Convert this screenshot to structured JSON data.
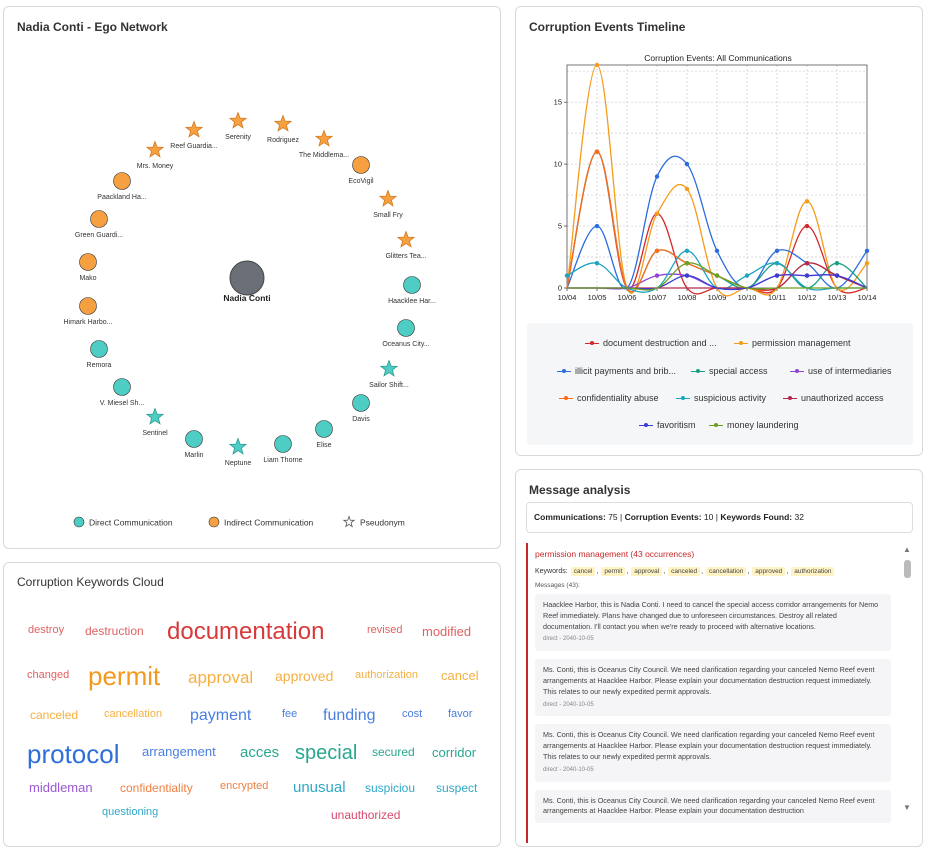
{
  "network": {
    "title": "Nadia Conti - Ego Network",
    "center": "Nadia Conti",
    "nodes": [
      {
        "label": "Reef Guardia...",
        "type": "pseudonym"
      },
      {
        "label": "Serenity",
        "type": "pseudonym"
      },
      {
        "label": "Rodriguez",
        "type": "pseudonym"
      },
      {
        "label": "The Middlema...",
        "type": "pseudonym"
      },
      {
        "label": "EcoVigil",
        "type": "indirect"
      },
      {
        "label": "Small Fry",
        "type": "pseudonym"
      },
      {
        "label": "Glitters Tea...",
        "type": "pseudonym"
      },
      {
        "label": "Haacklee Har...",
        "type": "direct"
      },
      {
        "label": "Oceanus City...",
        "type": "direct"
      },
      {
        "label": "Sailor Shift...",
        "type": "pseudonym_direct"
      },
      {
        "label": "Davis",
        "type": "direct"
      },
      {
        "label": "Elise",
        "type": "direct"
      },
      {
        "label": "Liam Thorne",
        "type": "direct"
      },
      {
        "label": "Neptune",
        "type": "pseudonym_direct"
      },
      {
        "label": "Marlin",
        "type": "direct"
      },
      {
        "label": "Sentinel",
        "type": "pseudonym_direct"
      },
      {
        "label": "V. Miesel Sh...",
        "type": "direct"
      },
      {
        "label": "Remora",
        "type": "direct"
      },
      {
        "label": "Himark Harbo...",
        "type": "indirect"
      },
      {
        "label": "Mako",
        "type": "indirect"
      },
      {
        "label": "Green Guardi...",
        "type": "indirect"
      },
      {
        "label": "Paackland Ha...",
        "type": "indirect"
      },
      {
        "label": "Mrs. Money",
        "type": "pseudonym"
      }
    ],
    "legend": {
      "direct": "Direct Communication",
      "indirect": "Indirect Communication",
      "pseudonym": "Pseudonym"
    },
    "colors": {
      "direct": "#4ecdc4",
      "indirect": "#f7a042",
      "center": "#6b7078"
    }
  },
  "timeline": {
    "title": "Corruption Events Timeline"
  },
  "chart_data": {
    "type": "line",
    "title": "Corruption Events: All Communications",
    "x": [
      "10/04",
      "10/05",
      "10/06",
      "10/07",
      "10/08",
      "10/09",
      "10/10",
      "10/11",
      "10/12",
      "10/13",
      "10/14"
    ],
    "ylim": [
      0,
      18
    ],
    "yticks": [
      0,
      5,
      10,
      15
    ],
    "grid": true,
    "series": [
      {
        "name": "document destruction and ...",
        "color": "#d62728",
        "values": [
          0,
          11,
          0,
          6,
          0,
          0,
          0,
          0,
          5,
          0,
          0
        ]
      },
      {
        "name": "permission management",
        "color": "#f59c1a",
        "values": [
          0,
          18,
          0,
          6,
          8,
          0,
          0,
          0,
          7,
          0,
          2
        ]
      },
      {
        "name": "illicit payments and brib...",
        "color": "#2b6cdf",
        "values": [
          0,
          5,
          0,
          9,
          10,
          3,
          0,
          3,
          2,
          0,
          3
        ]
      },
      {
        "name": "special access",
        "color": "#17a085",
        "values": [
          0,
          11,
          0,
          3,
          2,
          1,
          0,
          2,
          0,
          2,
          0
        ]
      },
      {
        "name": "use of intermediaries",
        "color": "#8e44d9",
        "values": [
          0,
          0,
          0,
          1,
          1,
          0,
          0,
          1,
          1,
          1,
          0
        ]
      },
      {
        "name": "confidentiality abuse",
        "color": "#ff6b1a",
        "values": [
          0,
          11,
          0,
          3,
          2,
          1,
          0,
          0,
          2,
          1,
          0
        ]
      },
      {
        "name": "suspicious activity",
        "color": "#1ea3c0",
        "values": [
          1,
          2,
          0,
          0,
          3,
          0,
          1,
          2,
          0,
          0,
          0
        ]
      },
      {
        "name": "unauthorized access",
        "color": "#b22a4a",
        "values": [
          0,
          0,
          0,
          0,
          0,
          0,
          0,
          0,
          2,
          1,
          0
        ]
      },
      {
        "name": "favoritism",
        "color": "#3b3bd6",
        "values": [
          0,
          0,
          0,
          0,
          1,
          0,
          0,
          1,
          1,
          1,
          0
        ]
      },
      {
        "name": "money laundering",
        "color": "#6aa020",
        "values": [
          0,
          0,
          0,
          0,
          2,
          1,
          0,
          0,
          0,
          0,
          0
        ]
      }
    ]
  },
  "keywords": {
    "title": "Corruption Keywords Cloud",
    "words": [
      {
        "text": "destroy",
        "color": "#e06262",
        "size": 11
      },
      {
        "text": "destruction",
        "color": "#e06262",
        "size": 12
      },
      {
        "text": "documentation",
        "color": "#d63a3a",
        "size": 24
      },
      {
        "text": "revised",
        "color": "#e06262",
        "size": 11
      },
      {
        "text": "modified",
        "color": "#e06262",
        "size": 13
      },
      {
        "text": "changed",
        "color": "#e06262",
        "size": 11
      },
      {
        "text": "permit",
        "color": "#f39a1e",
        "size": 26
      },
      {
        "text": "approval",
        "color": "#f5b041",
        "size": 17
      },
      {
        "text": "approved",
        "color": "#f5b041",
        "size": 14
      },
      {
        "text": "authorization",
        "color": "#f5b041",
        "size": 11
      },
      {
        "text": "cancel",
        "color": "#f5b041",
        "size": 13
      },
      {
        "text": "canceled",
        "color": "#f5b041",
        "size": 12
      },
      {
        "text": "cancellation",
        "color": "#f5b041",
        "size": 11
      },
      {
        "text": "payment",
        "color": "#4a7fe0",
        "size": 16
      },
      {
        "text": "fee",
        "color": "#4a7fe0",
        "size": 11
      },
      {
        "text": "funding",
        "color": "#4a7fe0",
        "size": 16
      },
      {
        "text": "cost",
        "color": "#4a7fe0",
        "size": 11
      },
      {
        "text": "favor",
        "color": "#4a7fe0",
        "size": 11
      },
      {
        "text": "protocol",
        "color": "#2f6fd8",
        "size": 26
      },
      {
        "text": "arrangement",
        "color": "#4a7fe0",
        "size": 13
      },
      {
        "text": "acces",
        "color": "#2aa68f",
        "size": 15
      },
      {
        "text": "special",
        "color": "#2aa68f",
        "size": 20
      },
      {
        "text": "secured",
        "color": "#2aa68f",
        "size": 12
      },
      {
        "text": "corridor",
        "color": "#2aa68f",
        "size": 13
      },
      {
        "text": "middleman",
        "color": "#9b59d6",
        "size": 13
      },
      {
        "text": "confidentiality",
        "color": "#f08040",
        "size": 12
      },
      {
        "text": "encrypted",
        "color": "#f08040",
        "size": 11
      },
      {
        "text": "unusual",
        "color": "#2fa9c6",
        "size": 15
      },
      {
        "text": "suspiciou",
        "color": "#2fa9c6",
        "size": 12
      },
      {
        "text": "suspect",
        "color": "#2fa9c6",
        "size": 12
      },
      {
        "text": "questioning",
        "color": "#2fa9c6",
        "size": 11
      },
      {
        "text": "unauthorized",
        "color": "#d84a6e",
        "size": 12
      }
    ]
  },
  "messages": {
    "title": "Message analysis",
    "stats": {
      "comm_label": "Communications:",
      "comm_value": "75",
      "events_label": "Corruption Events:",
      "events_value": "10",
      "keywords_label": "Keywords Found:",
      "keywords_value": "32"
    },
    "group": {
      "title": "permission management (43 occurrences)",
      "keywords_label": "Keywords:",
      "keywords": [
        "cancel",
        "permit",
        "approval",
        "canceled",
        "cancellation",
        "approved",
        "authorization"
      ],
      "messages_label": "Messages (43):",
      "items": [
        {
          "text": "Haacklee Harbor, this is Nadia Conti. I need to cancel the special access corridor arrangements for Nemo Reef immediately. Plans have changed due to unforeseen circumstances. Destroy all related documentation. I'll contact you when we're ready to proceed with alternative locations.",
          "meta": "direct - 2040-10-05"
        },
        {
          "text": "Ms. Conti, this is Oceanus City Council. We need clarification regarding your canceled Nemo Reef event arrangements at Haacklee Harbor. Please explain your documentation destruction request immediately. This relates to our newly expedited permit approvals.",
          "meta": "direct - 2040-10-05"
        },
        {
          "text": "Ms. Conti, this is Oceanus City Council. We need clarification regarding your canceled Nemo Reef event arrangements at Haacklee Harbor. Please explain your documentation destruction request immediately. This relates to our newly expedited permit approvals.",
          "meta": "direct - 2040-10-05"
        },
        {
          "text": "Ms. Conti, this is Oceanus City Council. We need clarification regarding your canceled Nemo Reef event arrangements at Haacklee Harbor. Please explain your documentation destruction",
          "meta": ""
        }
      ]
    }
  }
}
